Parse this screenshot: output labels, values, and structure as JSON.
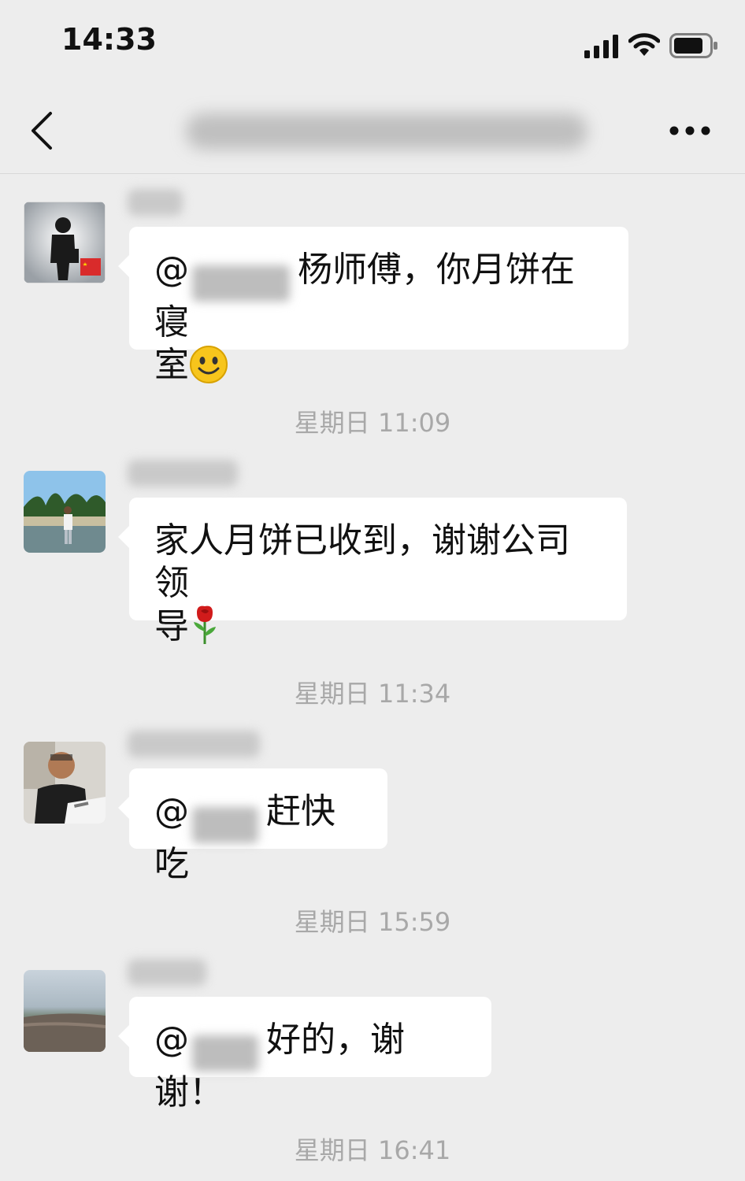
{
  "status_bar": {
    "time": "14:33",
    "icons": [
      "cellular-signal-icon",
      "wifi-icon",
      "battery-icon"
    ]
  },
  "nav": {
    "back_icon": "chevron-left-icon",
    "more_icon": "more-dots-icon"
  },
  "messages": [
    {
      "mention_prefix": "@",
      "text": "杨师傅，你月饼在寝",
      "text2": "室",
      "emoji": "smile-emoji-icon"
    },
    {
      "text": "家人月饼已收到，谢谢公司领",
      "text2": "导",
      "emoji": "rose-emoji-icon"
    },
    {
      "mention_prefix": "@",
      "text": "赶快吃"
    },
    {
      "mention_prefix": "@",
      "text": "好的，谢谢！"
    }
  ],
  "timestamps": [
    "星期日 11:09",
    "星期日 11:34",
    "星期日 15:59",
    "星期日 16:41"
  ],
  "colors": {
    "background": "#ededed",
    "bubble": "#ffffff",
    "timestamp_text": "#a8a8a8"
  }
}
